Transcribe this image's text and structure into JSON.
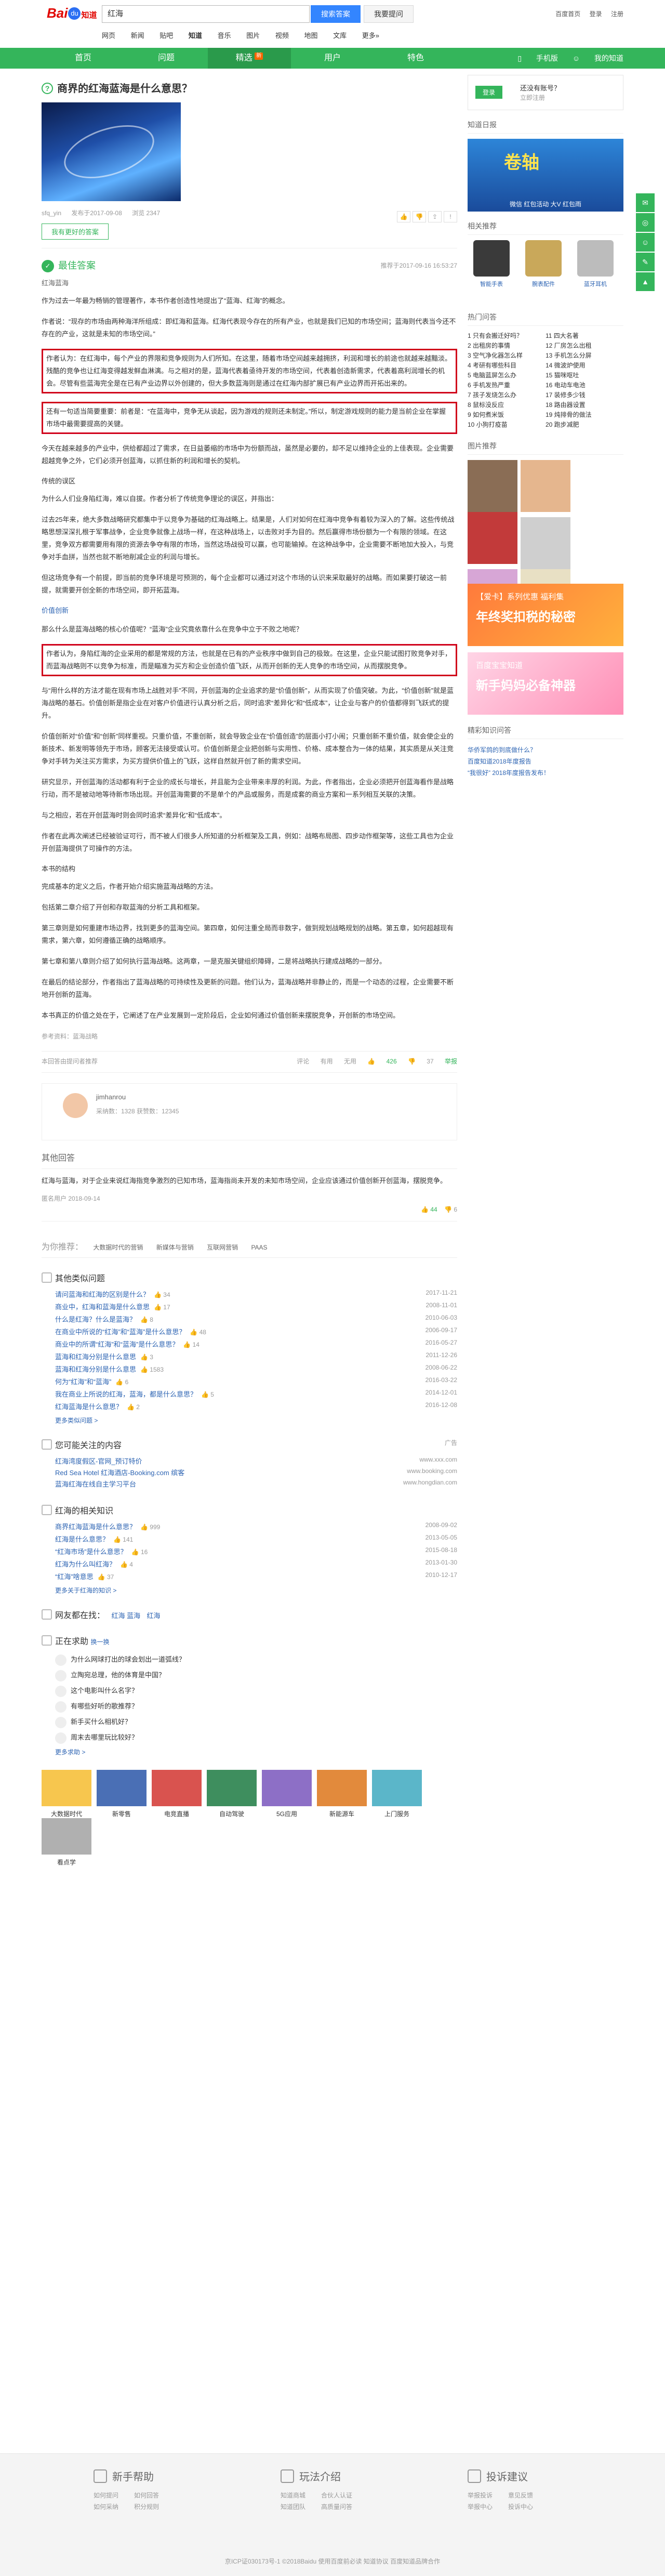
{
  "logo": {
    "bai": "Bai",
    "paw": "du",
    "zhi": "知道"
  },
  "search": {
    "value": "红海",
    "button": "搜索答案",
    "ask": "我要提问"
  },
  "topnav": [
    "网页",
    "新闻",
    "贴吧",
    "知道",
    "音乐",
    "图片",
    "视频",
    "地图",
    "文库",
    "更多»"
  ],
  "toplinks": [
    "百度首页",
    "登录",
    "注册"
  ],
  "greennav": {
    "items": [
      "首页",
      "问题",
      "精选",
      "用户",
      "特色"
    ],
    "new_badge": "新",
    "right": [
      "手机版",
      "我的知道"
    ]
  },
  "question": {
    "title": "商界的红海蓝海是什么意思？",
    "asker": "sfq_yin",
    "date": "发布于2017-09-08",
    "views": "浏览 2347",
    "tag_button": "我有更好的答案",
    "tools": [
      "赞",
      "踩",
      "分享",
      "举报"
    ]
  },
  "best": {
    "label": "最佳答案",
    "meta": "推荐于2017-09-16 16:53:27",
    "author": "红海蓝海",
    "paragraphs": [
      "作为过去一年最为畅销的管理著作，本书作者创造性地提出了“蓝海、红海”的概念。",
      "作者说：“现存的市场由两种海洋所组成：即红海和蓝海。红海代表现今存在的所有产业，也就是我们已知的市场空间；蓝海则代表当今还不存在的产业，这就是未知的市场空间。”"
    ],
    "highlight1": "作者认为：在红海中，每个产业的界限和竞争规则为人们所知。在这里，随着市场空间越来越拥挤，利润和增长的前途也就越来越黯淡。残酷的竞争也让红海变得越发鲜血淋漓。与之相对的是，蓝海代表着亟待开发的市场空间，代表着创造新需求，代表着高利润增长的机会。尽管有些蓝海完全是在已有产业边界以外创建的，但大多数蓝海则是通过在红海内部扩展已有产业边界而开拓出来的。",
    "highlight2": "还有一句适当简要重要：前者是：“在蓝海中，竞争无从谈起，因为游戏的规则还未制定。”所以，制定游戏规则的能力是当前企业在掌握市场中最需要提高的关键。",
    "paragraphs2": [
      "今天在越来越多的产业中，供给都超过了需求，在日益萎缩的市场中为份额而战，虽然是必要的，却不足以维持企业的上佳表现。企业需要超越竞争之外，它们必须开创蓝海，以抓住新的利润和增长的契机。",
      "传统的误区",
      "为什么人们业身陷红海，难以自拔。作者分析了传统竞争理论的误区，并指出：",
      "过去25年来，绝大多数战略研究都集中于以竞争为基础的红海战略上。结果是，人们对如何在红海中竞争有着较为深入的了解。这些传统战略思想深深扎根于军事战争，企业竞争就像上战场一样，在这种战场上，以击败对手为目的。然后赢得市场份额为一个有限的领域。在这里，竞争双方都需要用有限的资源去争夺有限的市场，当然这场战役可以赢，也可能输掉。在这种战争中，企业需要不断地加大投入，与竞争对手血拼，当然也就不断地削减企业的利润与增长。",
      "但这场竞争有一个前提，即当前的竞争环境是可预测的，每个企业都可以通过对这个市场的认识来采取最好的战略。而如果要打破这一前提，就需要开创全新的市场空间，即开拓蓝海。"
    ],
    "link1": "价值创新",
    "para3": "那么什么是蓝海战略的核心价值呢？“蓝海”企业究竟依靠什么在竞争中立于不败之地呢？",
    "highlight3": "作者认为，身陷红海的企业采用的都是常规的方法，也就是在已有的产业秩序中做到自己的极致。在这里，企业只能试图打败竞争对手，而蓝海战略则不以竞争为标准，而是瞄准为买方和企业创造价值飞跃，从而开创新的无人竞争的市场空间，从而摆脱竞争。",
    "paragraphs3": [
      "与“用什么样的方法才能在现有市场上战胜对手”不同，开创蓝海的企业追求的是“价值创新”，从而实现了价值突破。为此，“价值创新”就是蓝海战略的基石。价值创新是指企业在对客户价值进行认真分析之后，同时追求“差异化”和“低成本”，让企业与客户的价值都得到飞跃式的提升。",
      "价值创新对“价值”和“创新”同样重视。只重价值，不重创新，就会导致企业在“价值创造”的层面小打小闹；只重创新不重价值，就会使企业的新技术、新发明等领先于市场，顾客无法接受或认可。价值创新是企业把创新与实用性、价格、成本整合为一体的结果，其实质是从关注竞争对手转为关注买方需求，为买方提供价值上的飞跃，这样自然就开创了新的需求空间。",
      "研究显示，开创蓝海的活动都有利于企业的成长与增长，并且能为企业带来丰厚的利润。为此，作者指出，企业必须把开创蓝海看作是战略行动，而不是被动地等待新市场出现。开创蓝海需要的不是单个的产品或服务，而是成套的商业方案和一系列相互关联的决策。",
      "与之相应，若在开创蓝海时则会同时追求“差异化”和“低成本”。",
      "作者在此再次阐述已经被验证可行，而不被人们很多人所知道的分析框架及工具，例如：战略布局图、四步动作框架等，这些工具也为企业开创蓝海提供了可操作的方法。",
      "本书的结构",
      "完成基本的定义之后，作者开始介绍实施蓝海战略的方法。",
      "包括第二章介绍了开创和存取蓝海的分析工具和框架。",
      "第三章则是如何重建市场边界，找到更多的蓝海空间。第四章，如何注重全局而非数字，做到规划战略规划的战略。第五章，如何超越现有需求，第六章，如何遵循正确的战略顺序。",
      "第七章和第八章则介绍了如何执行蓝海战略。这两章，一是克服关键组织障碍，二是将战略执行建成战略的一部分。",
      "在最后的结论部分，作者指出了蓝海战略的可持续性及更新的问题。他们认为，蓝海战略并非静止的，而是一个动态的过程，企业需要不断地开创新的蓝海。",
      "本书真正的价值之处在于，它阐述了在产业发展到一定阶段后，企业如何通过价值创新来摆脱竞争，开创新的市场空间。"
    ],
    "sources": "参考资料：蓝海战略",
    "foot_left": "本回答由提问者推荐",
    "report": "举报",
    "foot_right": [
      "评论",
      "有用",
      "无用"
    ],
    "likes": "426",
    "dislikes": "37",
    "answerer_name": "jimhanrou",
    "answerer_level": "采纳数：1328 获赞数：12345"
  },
  "other": {
    "title": "其他回答",
    "text": "红海与蓝海，对于企业来说红海指竞争激烈的已知市场，蓝海指尚未开发的未知市场空间，企业应该通过价值创新开创蓝海，摆脱竞争。",
    "meta": "匿名用户 2018-09-14",
    "likes": "44",
    "dislikes": "6"
  },
  "tags": {
    "title": "为你推荐：",
    "items": [
      "大数据时代的营销",
      "新媒体与营销",
      "互联网营销",
      "PAAS"
    ]
  },
  "related": {
    "title": "其他类似问题",
    "items": [
      {
        "q": "请问蓝海和红海的区别是什么？",
        "n": "34",
        "d": "2017-11-21"
      },
      {
        "q": "商业中，红海和蓝海是什么意思",
        "n": "17",
        "d": "2008-11-01"
      },
      {
        "q": "什么是红海？什么是蓝海？",
        "n": "8",
        "d": "2010-06-03"
      },
      {
        "q": "在商业中所说的“红海”和“蓝海”是什么意思？",
        "n": "48",
        "d": "2006-09-17"
      },
      {
        "q": "商业中的所谓“红海”和“蓝海”是什么意思？",
        "n": "14",
        "d": "2016-05-27"
      },
      {
        "q": "蓝海和红海分别是什么意思",
        "n": "3",
        "d": "2011-12-26"
      },
      {
        "q": "蓝海和红海分别是什么意思",
        "n": "1583",
        "d": "2008-06-22"
      },
      {
        "q": "何为“红海”和“蓝海”",
        "n": "6",
        "d": "2016-03-22"
      },
      {
        "q": "我在商业上所说的红海，蓝海，都是什么意思？",
        "n": "5",
        "d": "2014-12-01"
      },
      {
        "q": "红海蓝海是什么意思？",
        "n": "2",
        "d": "2016-12-08"
      }
    ],
    "more": "更多类似问题 >"
  },
  "ads": {
    "title": "您可能关注的内容",
    "tag": "广告",
    "items": [
      {
        "q": "红海湾度假区-官网_预订特价",
        "d": "www.xxx.com"
      },
      {
        "q": "Red Sea Hotel 红海酒店-Booking.com 缤客",
        "d": "www.booking.com"
      },
      {
        "q": "蓝海红海在线自主学习平台",
        "d": "www.hongdian.com"
      }
    ]
  },
  "knowledge": {
    "title": "红海的相关知识",
    "items": [
      {
        "q": "商界红海蓝海是什么意思？",
        "n": "999",
        "d": "2008-09-02"
      },
      {
        "q": "红海是什么意思？",
        "n": "141",
        "d": "2013-05-05"
      },
      {
        "q": "“红海市场”是什么意思？",
        "n": "16",
        "d": "2015-08-18"
      },
      {
        "q": "红海为什么叫红海？",
        "n": "4",
        "d": "2013-01-30"
      },
      {
        "q": "“红海”啥意思",
        "n": "37",
        "d": "2010-12-17"
      }
    ],
    "more": "更多关于红海的知识 >"
  },
  "netfriends": {
    "label": "网友都在找：",
    "items": [
      "红海 蓝海",
      "红海"
    ]
  },
  "recent": {
    "title": "正在求助",
    "tag": "换一换",
    "items": [
      "为什么网球打出的球会划出一道弧线？",
      "立陶宛总理，他的体育是中国？",
      "这个电影叫什么名字？",
      "有哪些好听的歌推荐？",
      "新手买什么相机好？",
      "周末去哪里玩比较好？"
    ],
    "more": "更多求助 >"
  },
  "thumbs": [
    "大数据时代",
    "新零售",
    "电竞直播",
    "自动驾驶",
    "5G应用",
    "新能源车",
    "上门服务",
    "看点学"
  ],
  "side": {
    "login_btn": "登录",
    "login_t1": "还没有账号？",
    "login_t2": "立即注册",
    "zhidao_title": "知道日报",
    "promo_big": "卷轴",
    "promo_cap": "微信 红包活动 大V 红包雨",
    "prod_title": "相关推荐",
    "prods": [
      "智能手表",
      "腕表配件",
      "蓝牙耳机"
    ],
    "hot_title": "热门问答",
    "hot_left": [
      "1 只有会搬迁好吗？",
      "2 出租房的事情",
      "3 空气净化器怎么样",
      "4 考研有哪些科目",
      "5 电脑蓝屏怎么办",
      "6 手机发热严重",
      "7 孩子发烧怎么办",
      "8 鼠标没反应",
      "9 如何煮米饭",
      "10 小狗打疫苗"
    ],
    "hot_right": [
      "11 四大名著",
      "12 厂房怎么出租",
      "13 手机怎么分屏",
      "14 微波炉使用",
      "15 猫咪呕吐",
      "16 电动车电池",
      "17 装修多少钱",
      "18 路由器设置",
      "19 炖排骨的做法",
      "20 跑步减肥"
    ],
    "img_title": "图片推荐",
    "banner1_t": "【爱卡】系列优惠 福利集",
    "banner1_b": "年终奖扣税的秘密",
    "banner2_t": "百度宝宝知道",
    "banner2_b": "新手妈妈必备神器",
    "bottom_title": "精彩知识问答",
    "bottom_items": [
      "华侨军鸽的到底做什么？",
      "百度知道2018年度报告",
      "“我很好” 2018年度报告发布！"
    ]
  },
  "footer": {
    "cols": [
      {
        "title": "新手帮助",
        "links": [
          "如何提问",
          "如何回答",
          "如何采纳",
          "积分规则"
        ]
      },
      {
        "title": "玩法介绍",
        "links": [
          "知道商城",
          "合伙人认证",
          "知道团队",
          "高质量问答"
        ]
      },
      {
        "title": "投诉建议",
        "links": [
          "举报投诉",
          "意见反馈",
          "举报中心",
          "投诉中心"
        ]
      }
    ],
    "copyright": "京ICP证030173号-1 ©2018Baidu 使用百度前必读 知道协议 百度知道品牌合作"
  }
}
